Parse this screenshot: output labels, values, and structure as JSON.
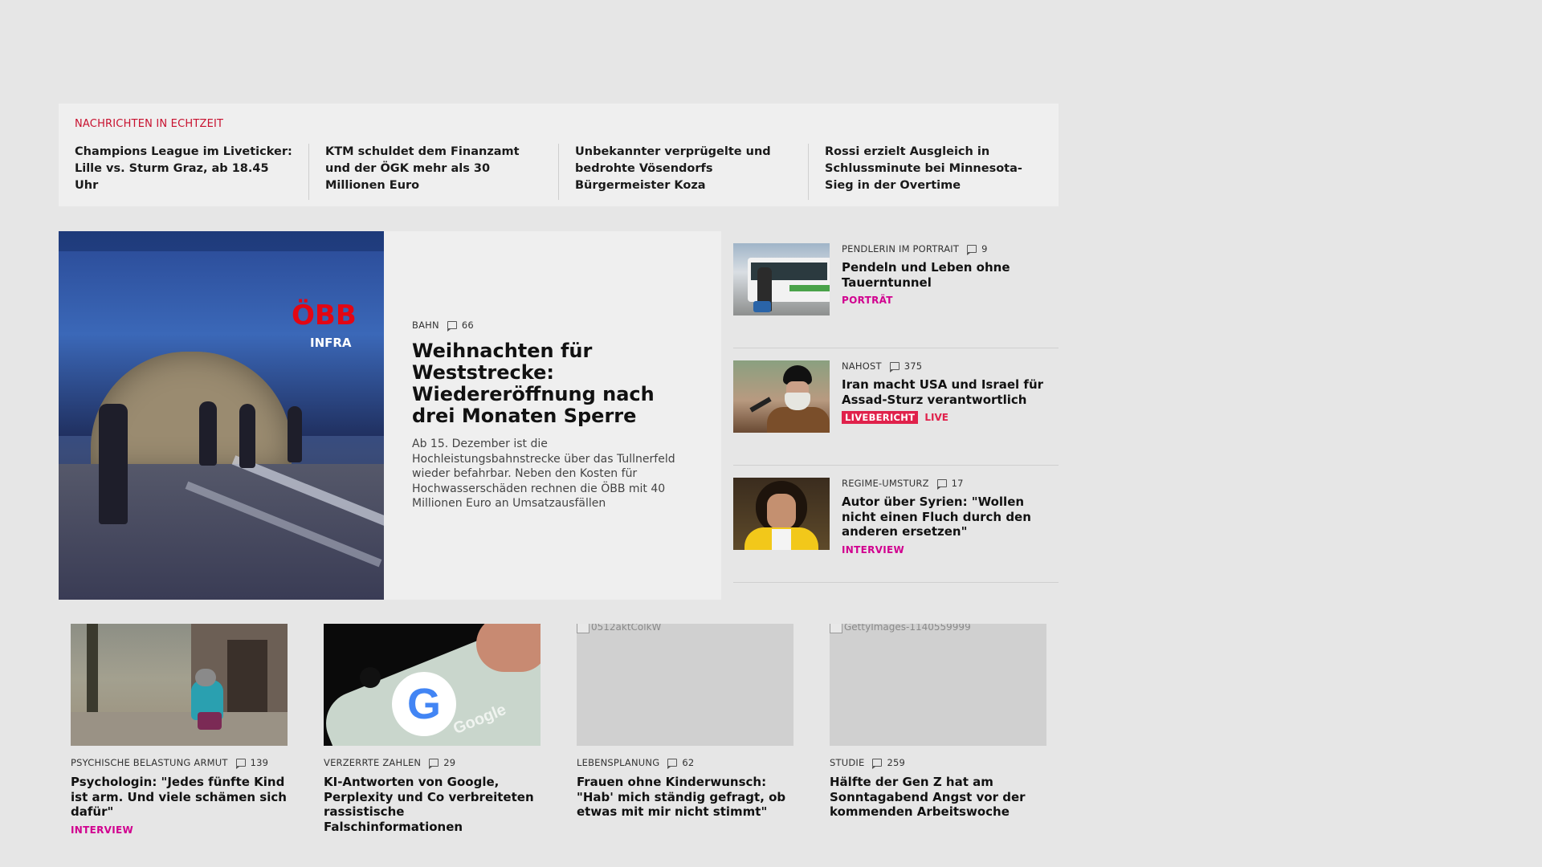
{
  "ticker": {
    "label": "NACHRICHTEN IN ECHTZEIT",
    "items": [
      "Champions League im Liveticker: Lille vs. Sturm Graz, ab 18.45 Uhr",
      "KTM schuldet dem Finanzamt und der ÖGK mehr als 30 Millionen Euro",
      "Unbekannter verprügelte und bedrohte Vösendorfs Bürgermeister Koza",
      "Rossi erzielt Ausgleich in Schlussminute bei Minnesota-Sieg in der Overtime"
    ]
  },
  "hero": {
    "image_logo": "ÖBB",
    "image_logo_sub": "INFRA",
    "kicker": "BAHN",
    "comments": "66",
    "title": "Weihnachten für Weststrecke: Wiedereröffnung nach drei Monaten Sperre",
    "teaser": "Ab 15. Dezember ist die Hochleistungsbahnstrecke über das Tullnerfeld wieder befahrbar. Neben den Kosten für Hochwasserschäden rechnen die ÖBB mit 40 Millionen Euro an Umsatzausfällen"
  },
  "side": [
    {
      "kicker": "PENDLERIN IM PORTRAIT",
      "comments": "9",
      "title": "Pendeln und Leben ohne Tauerntunnel",
      "tag": "PORTRÄT"
    },
    {
      "kicker": "NAHOST",
      "comments": "375",
      "title": "Iran macht USA und Israel für Assad-Sturz verantwortlich",
      "badge": "LIVEBERICHT",
      "live": "LIVE"
    },
    {
      "kicker": "REGIME-UMSTURZ",
      "comments": "17",
      "title": "Autor über Syrien: \"Wollen nicht einen Fluch durch den anderen ersetzen\"",
      "tag": "INTERVIEW"
    }
  ],
  "cards": [
    {
      "kicker": "PSYCHISCHE BELASTUNG ARMUT",
      "comments": "139",
      "title": "Psychologin: \"Jedes fünfte Kind ist arm. Und viele schämen sich dafür\"",
      "tag": "INTERVIEW"
    },
    {
      "kicker": "VERZERRTE ZAHLEN",
      "comments": "29",
      "title": "KI-Antworten von Google, Perplexity und Co verbreiteten rassistische Falschinformationen",
      "image_text": "Google"
    },
    {
      "kicker": "LEBENSPLANUNG",
      "comments": "62",
      "title": "Frauen ohne Kinderwunsch: \"Hab' mich ständig gefragt, ob etwas mit mir nicht stimmt\"",
      "image_alt": "0512aktColkW"
    },
    {
      "kicker": "STUDIE",
      "comments": "259",
      "title": "Hälfte der Gen Z hat am Sonntagabend Angst vor der kommenden Arbeitswoche",
      "image_alt": "GettyImages-1140559999"
    }
  ]
}
